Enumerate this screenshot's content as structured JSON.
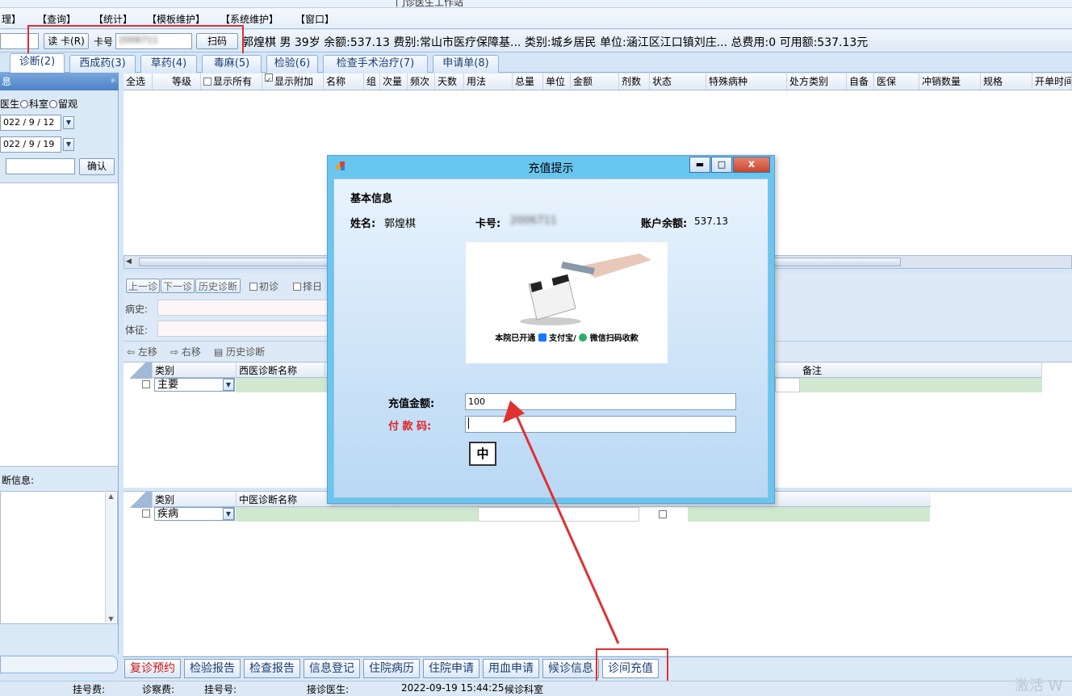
{
  "window": {
    "title_fragment": "门诊医生工作站"
  },
  "menu": [
    "理】",
    "【查询】",
    "【统计】",
    "【模板维护】",
    "【系统维护】",
    "【窗口】"
  ],
  "toolbar": {
    "read_card": "读 卡(R)",
    "card_label": "卡号",
    "card_value": "2006711",
    "scan": "扫码",
    "patient_info": "郭煌棋 男 39岁 余额:537.13  费别:常山市医疗保障基...  类别:城乡居民  单位:涵江区江口镇刘庄...  总费用:0  可用额:537.13元"
  },
  "tabs": [
    "诊断(2)",
    "西成药(3)",
    "草药(4)",
    "毒麻(5)",
    "检验(6)",
    "检查手术治疗(7)",
    "申请单(8)"
  ],
  "left_panel": {
    "header": "息",
    "pin": "ᵖ",
    "radio_doctor": "医生",
    "radio_dept": "科室",
    "radio_observe": "留观",
    "date_start": "022 / 9 / 12",
    "date_end": "022 / 9 / 19",
    "confirm": "确认",
    "diag_info": "断信息:"
  },
  "order_grid": {
    "columns": [
      "全选",
      "等级",
      "显示所有",
      "显示附加",
      "名称",
      "组",
      "次量",
      "频次",
      "天数",
      "用法",
      "总量",
      "单位",
      "金额",
      "剂数",
      "状态",
      "特殊病种",
      "处方类别",
      "自备",
      "医保",
      "冲销数量",
      "规格",
      "开单时间"
    ]
  },
  "visit_toolbar": {
    "prev": "上一诊",
    "next": "下一诊",
    "history": "历史诊断",
    "first_visit": "初诊",
    "choose_day": "择日",
    "history_label": "病史:",
    "sign_label": "体征:"
  },
  "diag_toolbar": {
    "left": "左移",
    "right": "右移",
    "history": "历史诊断"
  },
  "west_grid": {
    "col_type": "类别",
    "col_name": "西医诊断名称",
    "col_note": "备注",
    "row_type": "主要"
  },
  "tcm_grid": {
    "col_type": "类别",
    "col_name": "中医诊断名称",
    "row_type": "疾病"
  },
  "bottom_buttons": [
    "复诊预约",
    "检验报告",
    "检查报告",
    "信息登记",
    "住院病历",
    "住院申请",
    "用血申请",
    "候诊信息",
    "诊间充值"
  ],
  "status": {
    "reg_fee": "挂号费:",
    "exam_fee": "诊察费:",
    "reg_no": "挂号号:",
    "doctor": "接诊医生:",
    "datetime": "2022-09-19 15:44:25",
    "dept": "候诊科室"
  },
  "dialog": {
    "title": "充值提示",
    "section": "基本信息",
    "name_label": "姓名:",
    "name": "郭煌棋",
    "card_label": "卡号:",
    "card_value": "2006711",
    "balance_label": "账户余额:",
    "balance": "537.13",
    "ad_text": "本院已开通",
    "ad_alipay": "支付宝/",
    "ad_wechat": "微信扫码收款",
    "amount_label": "充值金额:",
    "amount_value": "100",
    "paycode_label": "付 款 码:",
    "ime": "中",
    "min": "▬",
    "max": "□",
    "close": "x"
  },
  "colors": {
    "accent": "#e03030",
    "dialog_title": "#69c6ef"
  },
  "watermark": "激活 W"
}
